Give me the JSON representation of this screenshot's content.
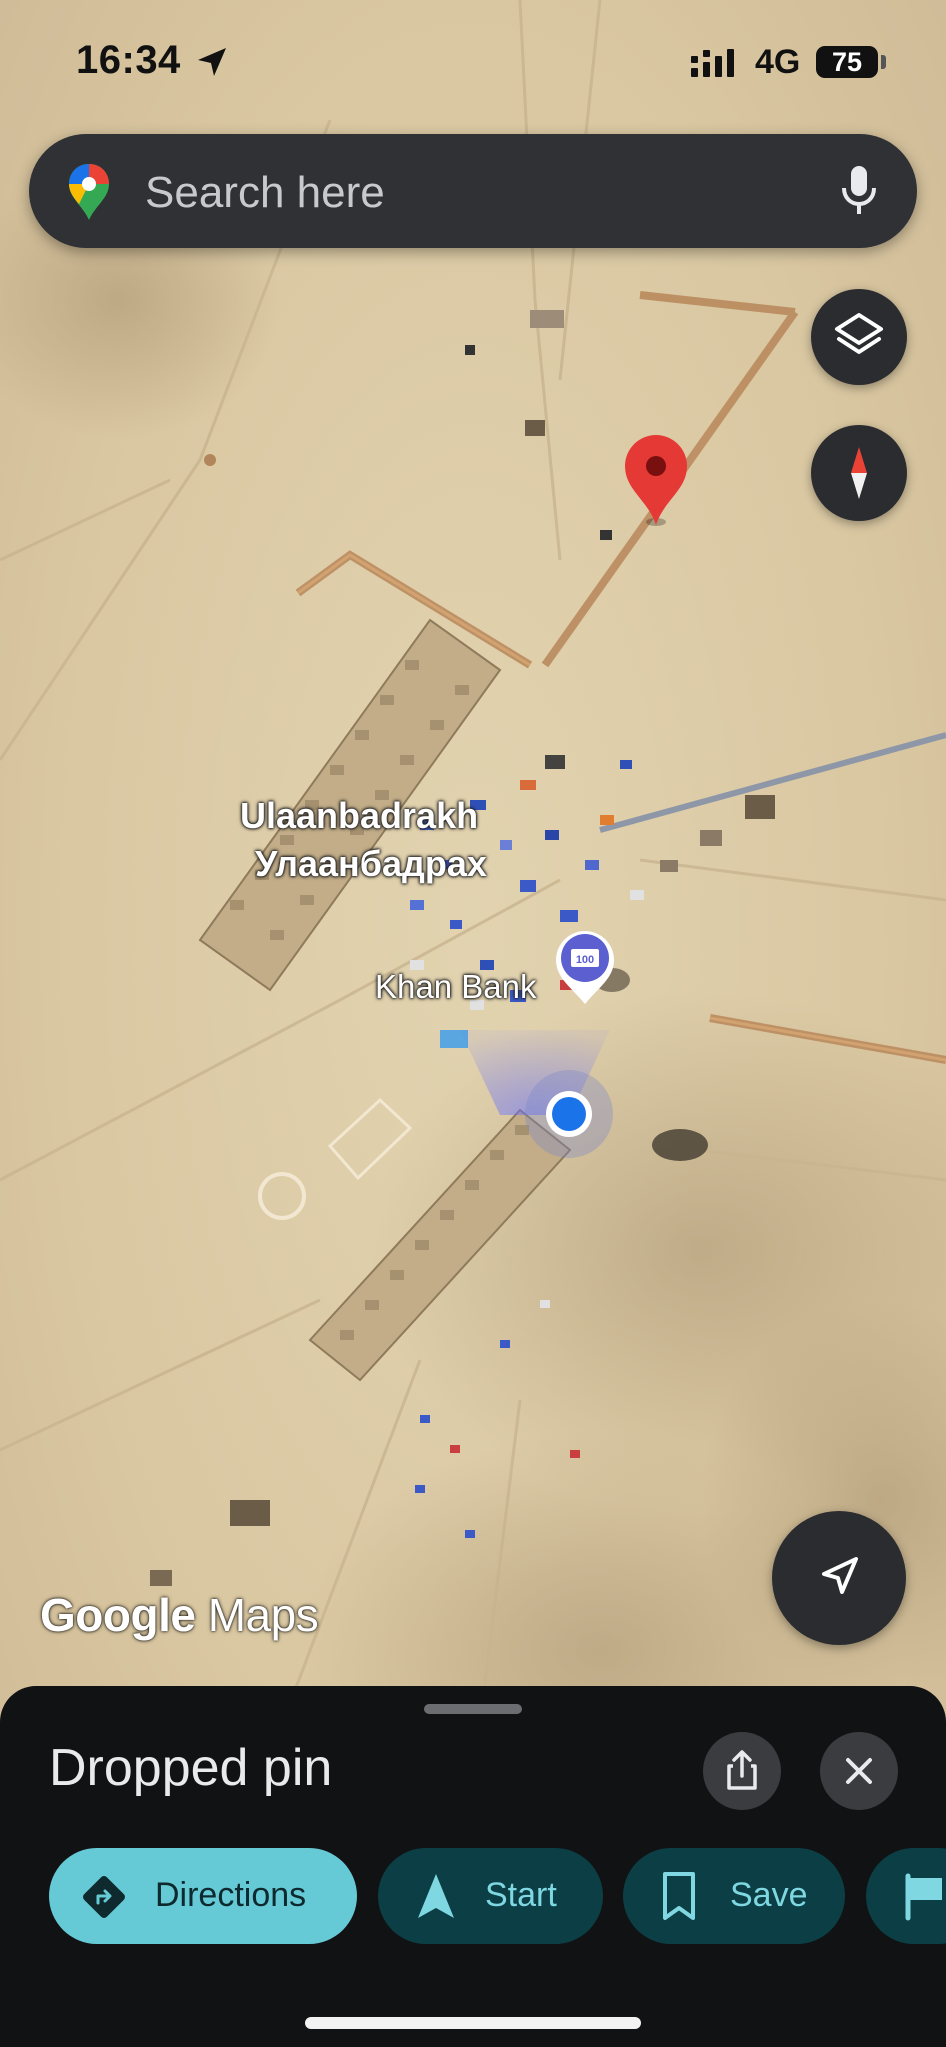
{
  "status_bar": {
    "time": "16:34",
    "network": "4G",
    "battery": "75",
    "battery_level_percent": 75
  },
  "search": {
    "placeholder": "Search here"
  },
  "map": {
    "view": "satellite",
    "place_labels": {
      "town_latin": "Ulaanbadrakh",
      "town_cyrillic": "Улаанбадрах",
      "bank": "Khan Bank"
    },
    "watermark": {
      "brand": "Google",
      "product": "Maps"
    },
    "colors": {
      "pin": "#e53935",
      "location_dot": "#1a73e8",
      "bank_marker": "#5b5fcf",
      "road": "#8e97a7"
    }
  },
  "sheet": {
    "title": "Dropped pin",
    "actions": {
      "directions": "Directions",
      "start": "Start",
      "save": "Save"
    }
  },
  "icons": [
    "location-arrow-icon",
    "signal-icon",
    "google-maps-logo",
    "mic-icon",
    "layers-icon",
    "compass-icon",
    "navigation-arrow-icon",
    "share-icon",
    "close-icon",
    "directions-icon",
    "start-arrow-icon",
    "bookmark-icon",
    "flag-icon"
  ]
}
